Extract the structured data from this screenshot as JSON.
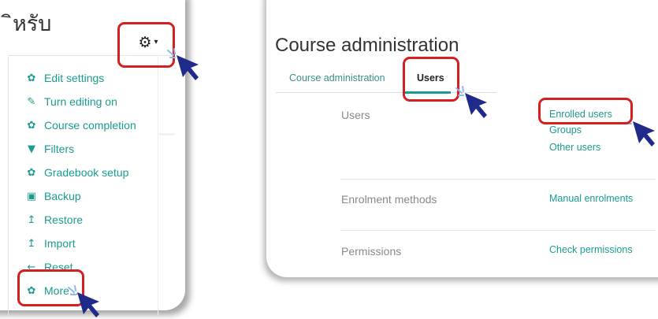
{
  "left_panel": {
    "title": "ิหรับ",
    "gear_icon": "gear-icon",
    "caret": "▾",
    "menu": [
      {
        "label": "Edit settings",
        "icon": "gear-icon",
        "glyph": "✿"
      },
      {
        "label": "Turn editing on",
        "icon": "pencil-icon",
        "glyph": "✎"
      },
      {
        "label": "Course completion",
        "icon": "gear-icon",
        "glyph": "✿"
      },
      {
        "label": "Filters",
        "icon": "filter-icon",
        "glyph": "▼"
      },
      {
        "label": "Gradebook setup",
        "icon": "gear-icon",
        "glyph": "✿"
      },
      {
        "label": "Backup",
        "icon": "backup-icon",
        "glyph": "▣"
      },
      {
        "label": "Restore",
        "icon": "upload-icon",
        "glyph": "↥"
      },
      {
        "label": "Import",
        "icon": "upload-icon",
        "glyph": "↥"
      },
      {
        "label": "Reset",
        "icon": "arrow-left-icon",
        "glyph": "←"
      },
      {
        "label": "More...",
        "icon": "gear-icon",
        "glyph": "✿"
      }
    ]
  },
  "right_panel": {
    "title": "Course administration",
    "tabs": [
      {
        "label": "Course administration"
      },
      {
        "label": "Users"
      }
    ],
    "sections": [
      {
        "label": "Users",
        "links": [
          "Enrolled users",
          "Groups",
          "Other users"
        ]
      },
      {
        "label": "Enrolment methods",
        "links": [
          "Manual enrolments"
        ]
      },
      {
        "label": "Permissions",
        "links": [
          "Check permissions"
        ]
      }
    ]
  },
  "colors": {
    "link": "#1a9c8f",
    "highlight": "#d42020",
    "cursor": "#1f2a8a",
    "sparkle": "#8fb8e8"
  }
}
